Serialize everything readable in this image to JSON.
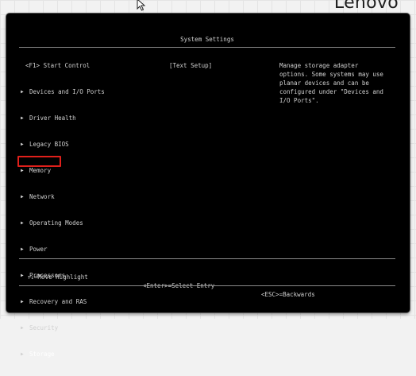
{
  "brand": "Lenovo",
  "screen": {
    "title": "System Settings",
    "menu_header": "<F1> Start Control",
    "mode_label": "[Text Setup]",
    "menu": [
      {
        "label": "Devices and I/O Ports"
      },
      {
        "label": "Driver Health"
      },
      {
        "label": "Legacy BIOS"
      },
      {
        "label": "Memory"
      },
      {
        "label": "Network"
      },
      {
        "label": "Operating Modes"
      },
      {
        "label": "Power"
      },
      {
        "label": "Processors"
      },
      {
        "label": "Recovery and RAS"
      },
      {
        "label": "Security"
      },
      {
        "label": "Storage",
        "selected": true
      }
    ],
    "help_lines": [
      "Manage storage adapter",
      "options. Some systems may use",
      "planar devices and can be",
      "configured under \"Devices and",
      "I/O Ports\"."
    ],
    "footer": {
      "move": "↑↓=Move Highlight",
      "enter": "<Enter>=Select Entry",
      "esc": "<ESC>=Backwards"
    }
  },
  "colors": {
    "screen_bg": "#000000",
    "text": "#d0d0d0",
    "highlight_border": "#e0201b"
  },
  "icons": {
    "menu_arrow": "triangle-right-icon",
    "cursor": "mouse-pointer-icon"
  }
}
